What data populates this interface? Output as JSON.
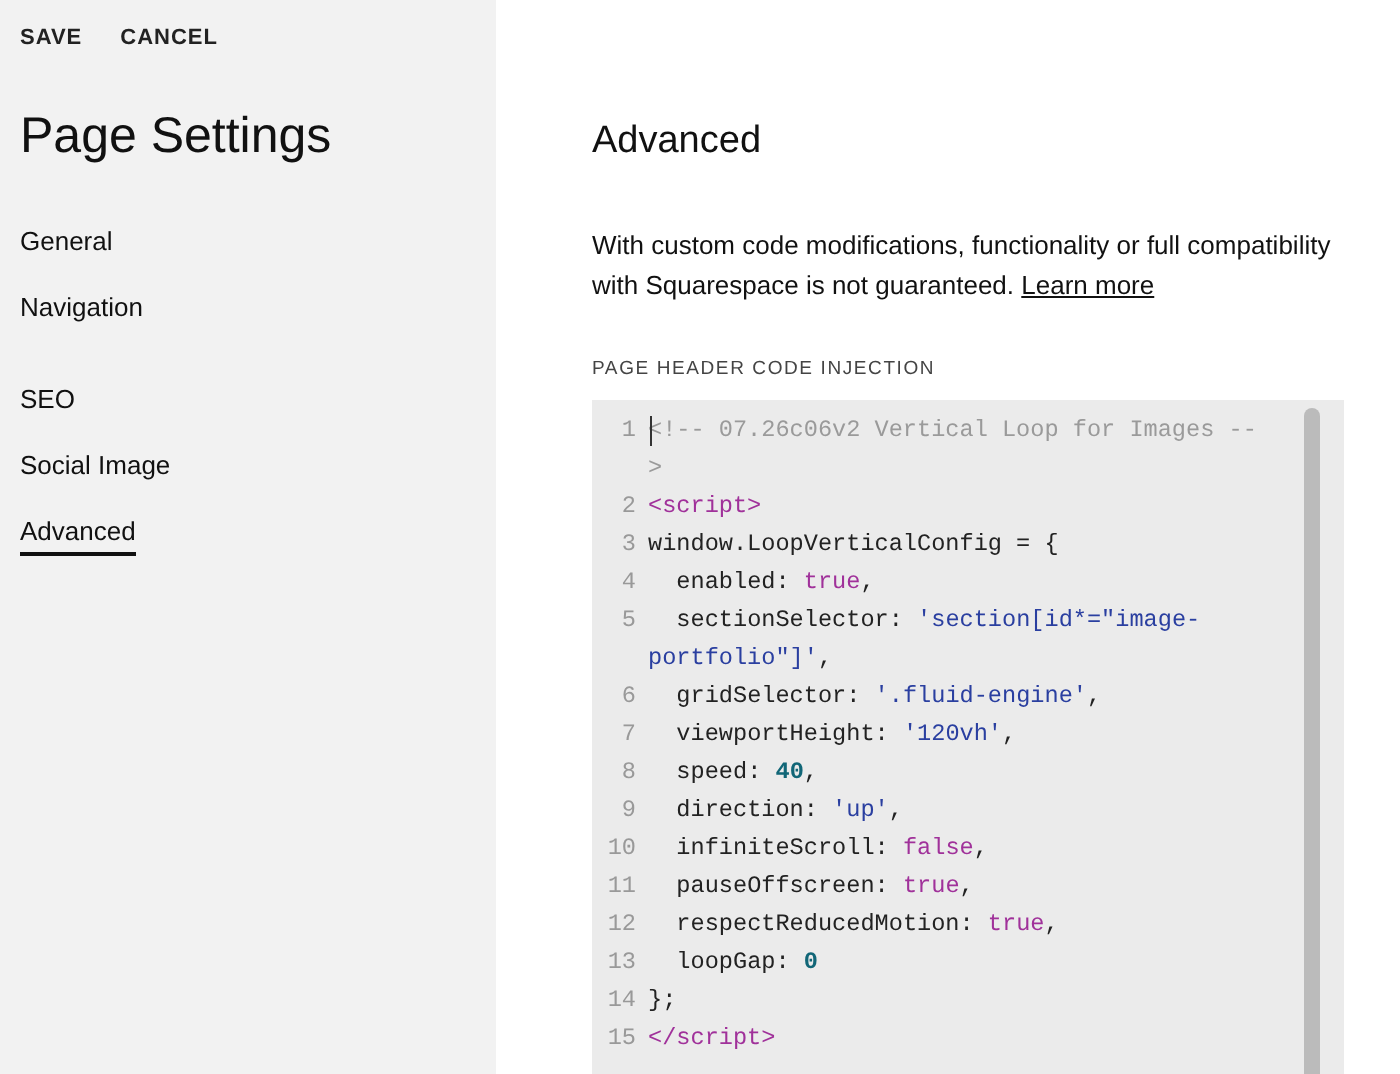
{
  "sidebar": {
    "actions": [
      {
        "label": "SAVE"
      },
      {
        "label": "CANCEL"
      }
    ],
    "title": "Page Settings",
    "nav_groups": [
      [
        {
          "label": "General",
          "selected": false
        },
        {
          "label": "Navigation",
          "selected": false
        }
      ],
      [
        {
          "label": "SEO",
          "selected": false
        },
        {
          "label": "Social Image",
          "selected": false
        },
        {
          "label": "Advanced",
          "selected": true
        }
      ]
    ]
  },
  "main": {
    "heading": "Advanced",
    "description": "With custom code modifications, functionality or full compatibility with Squarespace is not guaranteed.",
    "link": "Learn more",
    "section_label": "PAGE HEADER CODE INJECTION",
    "code_lines": [
      {
        "number": "1",
        "tokens": [
          {
            "kind": "comment",
            "text": "<!-- 07.26c06v2 Vertical Loop for Images -->"
          }
        ]
      },
      {
        "number": "2",
        "tokens": [
          {
            "kind": "tag",
            "text": "<script>"
          }
        ]
      },
      {
        "number": "3",
        "tokens": [
          {
            "kind": "plain",
            "text": "window.LoopVerticalConfig = {"
          }
        ]
      },
      {
        "number": "4",
        "tokens": [
          {
            "kind": "plain",
            "text": "  enabled: "
          },
          {
            "kind": "keyword",
            "text": "true"
          },
          {
            "kind": "plain",
            "text": ","
          }
        ]
      },
      {
        "number": "5",
        "tokens": [
          {
            "kind": "plain",
            "text": "  sectionSelector: "
          },
          {
            "kind": "string",
            "text": "'section[id*=\"image-portfolio\"]'"
          },
          {
            "kind": "plain",
            "text": ","
          }
        ]
      },
      {
        "number": "6",
        "tokens": [
          {
            "kind": "plain",
            "text": "  gridSelector: "
          },
          {
            "kind": "string",
            "text": "'.fluid-engine'"
          },
          {
            "kind": "plain",
            "text": ","
          }
        ]
      },
      {
        "number": "7",
        "tokens": [
          {
            "kind": "plain",
            "text": "  viewportHeight: "
          },
          {
            "kind": "string",
            "text": "'120vh'"
          },
          {
            "kind": "plain",
            "text": ","
          }
        ]
      },
      {
        "number": "8",
        "tokens": [
          {
            "kind": "plain",
            "text": "  speed: "
          },
          {
            "kind": "number",
            "text": "40"
          },
          {
            "kind": "plain",
            "text": ","
          }
        ]
      },
      {
        "number": "9",
        "tokens": [
          {
            "kind": "plain",
            "text": "  direction: "
          },
          {
            "kind": "string",
            "text": "'up'"
          },
          {
            "kind": "plain",
            "text": ","
          }
        ]
      },
      {
        "number": "10",
        "tokens": [
          {
            "kind": "plain",
            "text": "  infiniteScroll: "
          },
          {
            "kind": "keyword",
            "text": "false"
          },
          {
            "kind": "plain",
            "text": ","
          }
        ]
      },
      {
        "number": "11",
        "tokens": [
          {
            "kind": "plain",
            "text": "  pauseOffscreen: "
          },
          {
            "kind": "keyword",
            "text": "true"
          },
          {
            "kind": "plain",
            "text": ","
          }
        ]
      },
      {
        "number": "12",
        "tokens": [
          {
            "kind": "plain",
            "text": "  respectReducedMotion: "
          },
          {
            "kind": "keyword",
            "text": "true"
          },
          {
            "kind": "plain",
            "text": ","
          }
        ]
      },
      {
        "number": "13",
        "tokens": [
          {
            "kind": "plain",
            "text": "  loopGap: "
          },
          {
            "kind": "number",
            "text": "0"
          }
        ]
      },
      {
        "number": "14",
        "tokens": [
          {
            "kind": "plain",
            "text": "};"
          }
        ]
      },
      {
        "number": "15",
        "tokens": [
          {
            "kind": "tag",
            "text": "</script>"
          }
        ]
      }
    ]
  }
}
